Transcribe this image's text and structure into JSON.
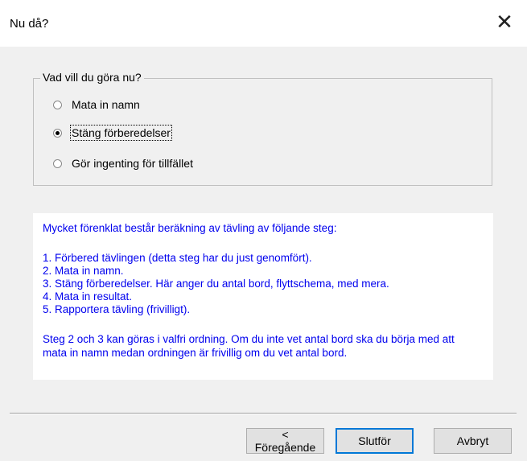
{
  "window": {
    "title": "Nu då?",
    "close_icon": "close-icon"
  },
  "group": {
    "legend": "Vad vill du göra nu?",
    "options": [
      {
        "label": "Mata in namn",
        "checked": false
      },
      {
        "label": "Stäng förberedelser",
        "checked": true
      },
      {
        "label": "Gör ingenting för tillfället",
        "checked": false
      }
    ]
  },
  "info": {
    "intro": "Mycket förenklat består beräkning av tävling av följande steg:",
    "steps": [
      "1. Förbered tävlingen (detta steg har du just genomfört).",
      "2. Mata in namn.",
      "3. Stäng förberedelser. Här anger du antal bord, flyttschema, med mera.",
      "4. Mata in resultat.",
      "5. Rapportera tävling (frivilligt)."
    ],
    "note_line1": "Steg 2 och 3 kan göras i valfri ordning. Om du inte vet antal bord ska du börja med att",
    "note_line2": "mata in namn medan ordningen är frivillig om du vet antal bord.",
    "text_color": "#0000ee"
  },
  "buttons": {
    "previous": "< Föregående",
    "finish": "Slutför",
    "cancel": "Avbryt"
  }
}
